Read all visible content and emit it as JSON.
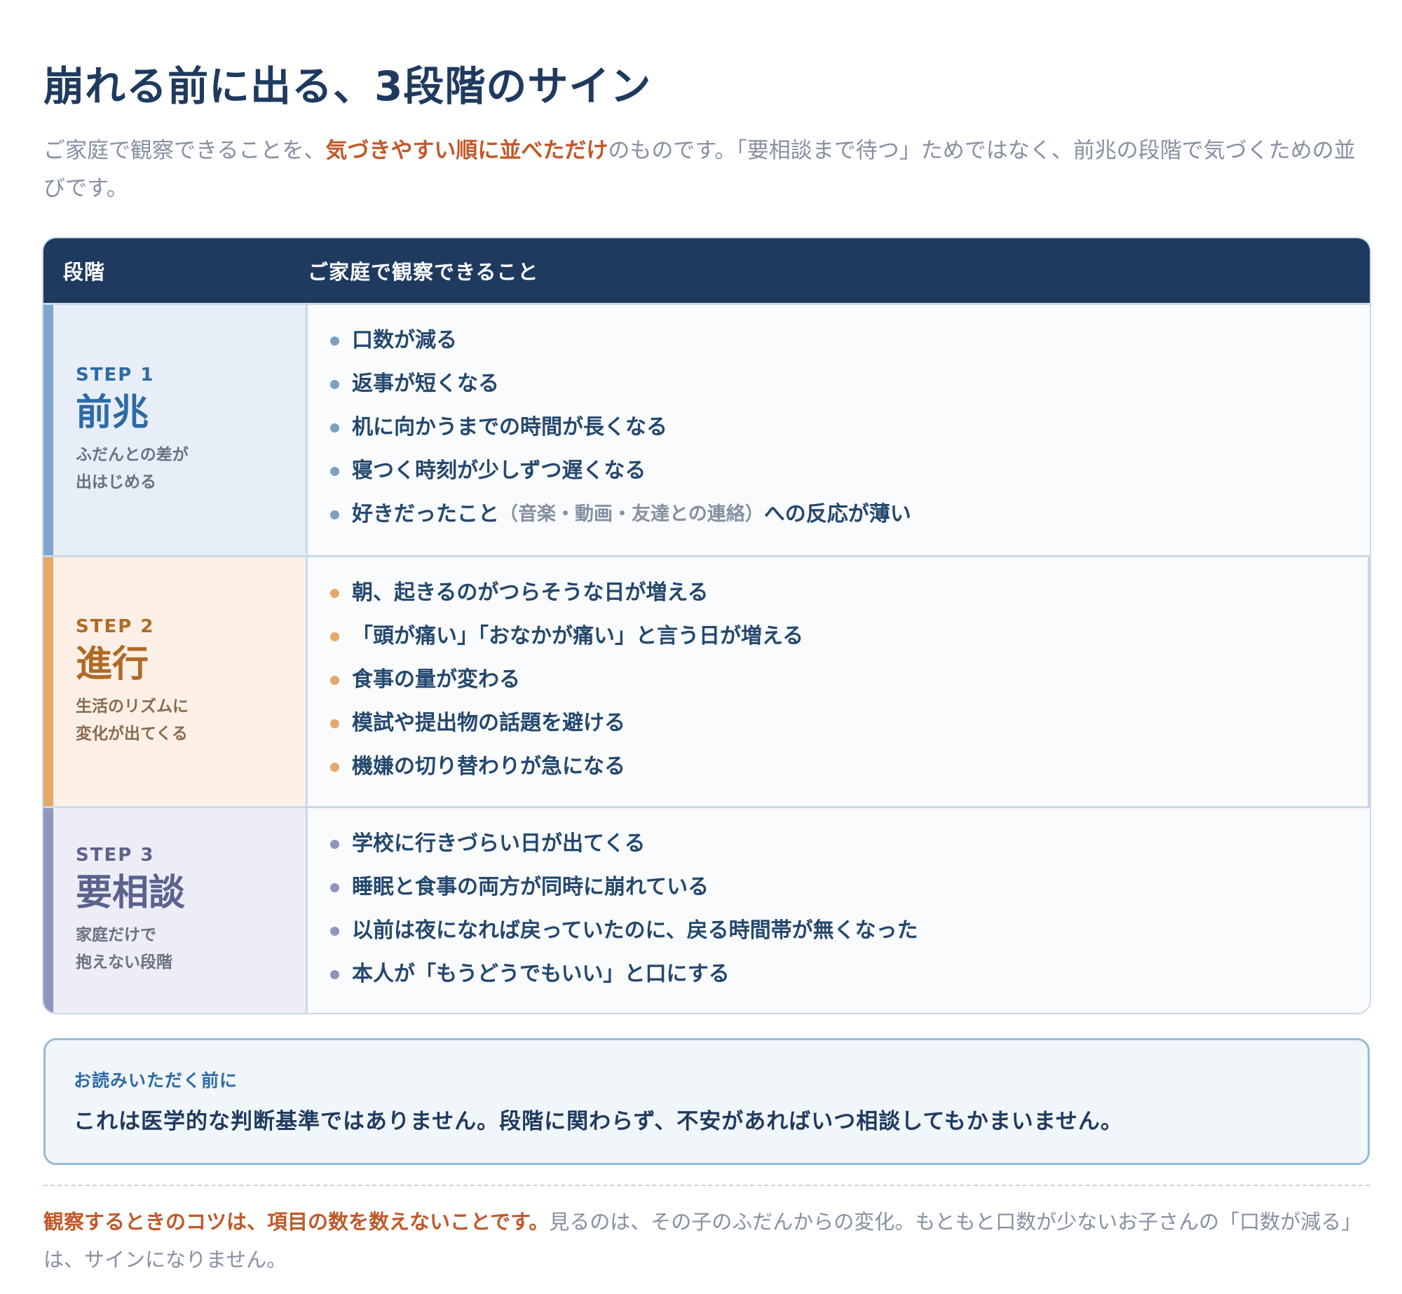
{
  "title": "崩れる前に出る、3段階のサイン",
  "intro": {
    "before": "ご家庭で観察できることを、",
    "highlight": "気づきやすい順に並べただけ",
    "after": "のものです。「要相談まで待つ」ためではなく、前兆の段階で気づくための並びです。"
  },
  "table": {
    "header_step": "段階",
    "header_obs": "ご家庭で観察できること",
    "rows": [
      {
        "label": "STEP 1",
        "name": "前兆",
        "desc1": "ふだんとの差が",
        "desc2": "出はじめる",
        "items": [
          "口数が減る",
          "返事が短くなる",
          "机に向かうまでの時間が長くなる",
          "寝つく時刻が少しずつ遅くなる",
          "好きだったこと"
        ],
        "item5_note": "（音楽・動画・友達との連絡）",
        "item5_after": "への反応が薄い"
      },
      {
        "label": "STEP 2",
        "name": "進行",
        "desc1": "生活のリズムに",
        "desc2": "変化が出てくる",
        "items": [
          "朝、起きるのがつらそうな日が増える",
          "「頭が痛い」「おなかが痛い」と言う日が増える",
          "食事の量が変わる",
          "模試や提出物の話題を避ける",
          "機嫌の切り替わりが急になる"
        ]
      },
      {
        "label": "STEP 3",
        "name": "要相談",
        "desc1": "家庭だけで",
        "desc2": "抱えない段階",
        "items": [
          "学校に行きづらい日が出てくる",
          "睡眠と食事の両方が同時に崩れている",
          "以前は夜になれば戻っていたのに、戻る時間帯が無くなった",
          "本人が「もうどうでもいい」と口にする"
        ]
      }
    ]
  },
  "callout": {
    "label": "お読みいただく前に",
    "text": "これは医学的な判断基準ではありません。段階に関わらず、不安があればいつ相談してもかまいません。"
  },
  "footer": {
    "highlight": "観察するときのコツは、項目の数を数えないことです。",
    "rest": "見るのは、その子のふだんからの変化。もともと口数が少ないお子さんの「口数が減る」は、サインになりません。"
  },
  "colors": {
    "navy": "#1f3a5f",
    "step1": "#7fa6cf",
    "step2": "#e5a866",
    "step3": "#8f95c0",
    "accent": "#c0592a"
  }
}
